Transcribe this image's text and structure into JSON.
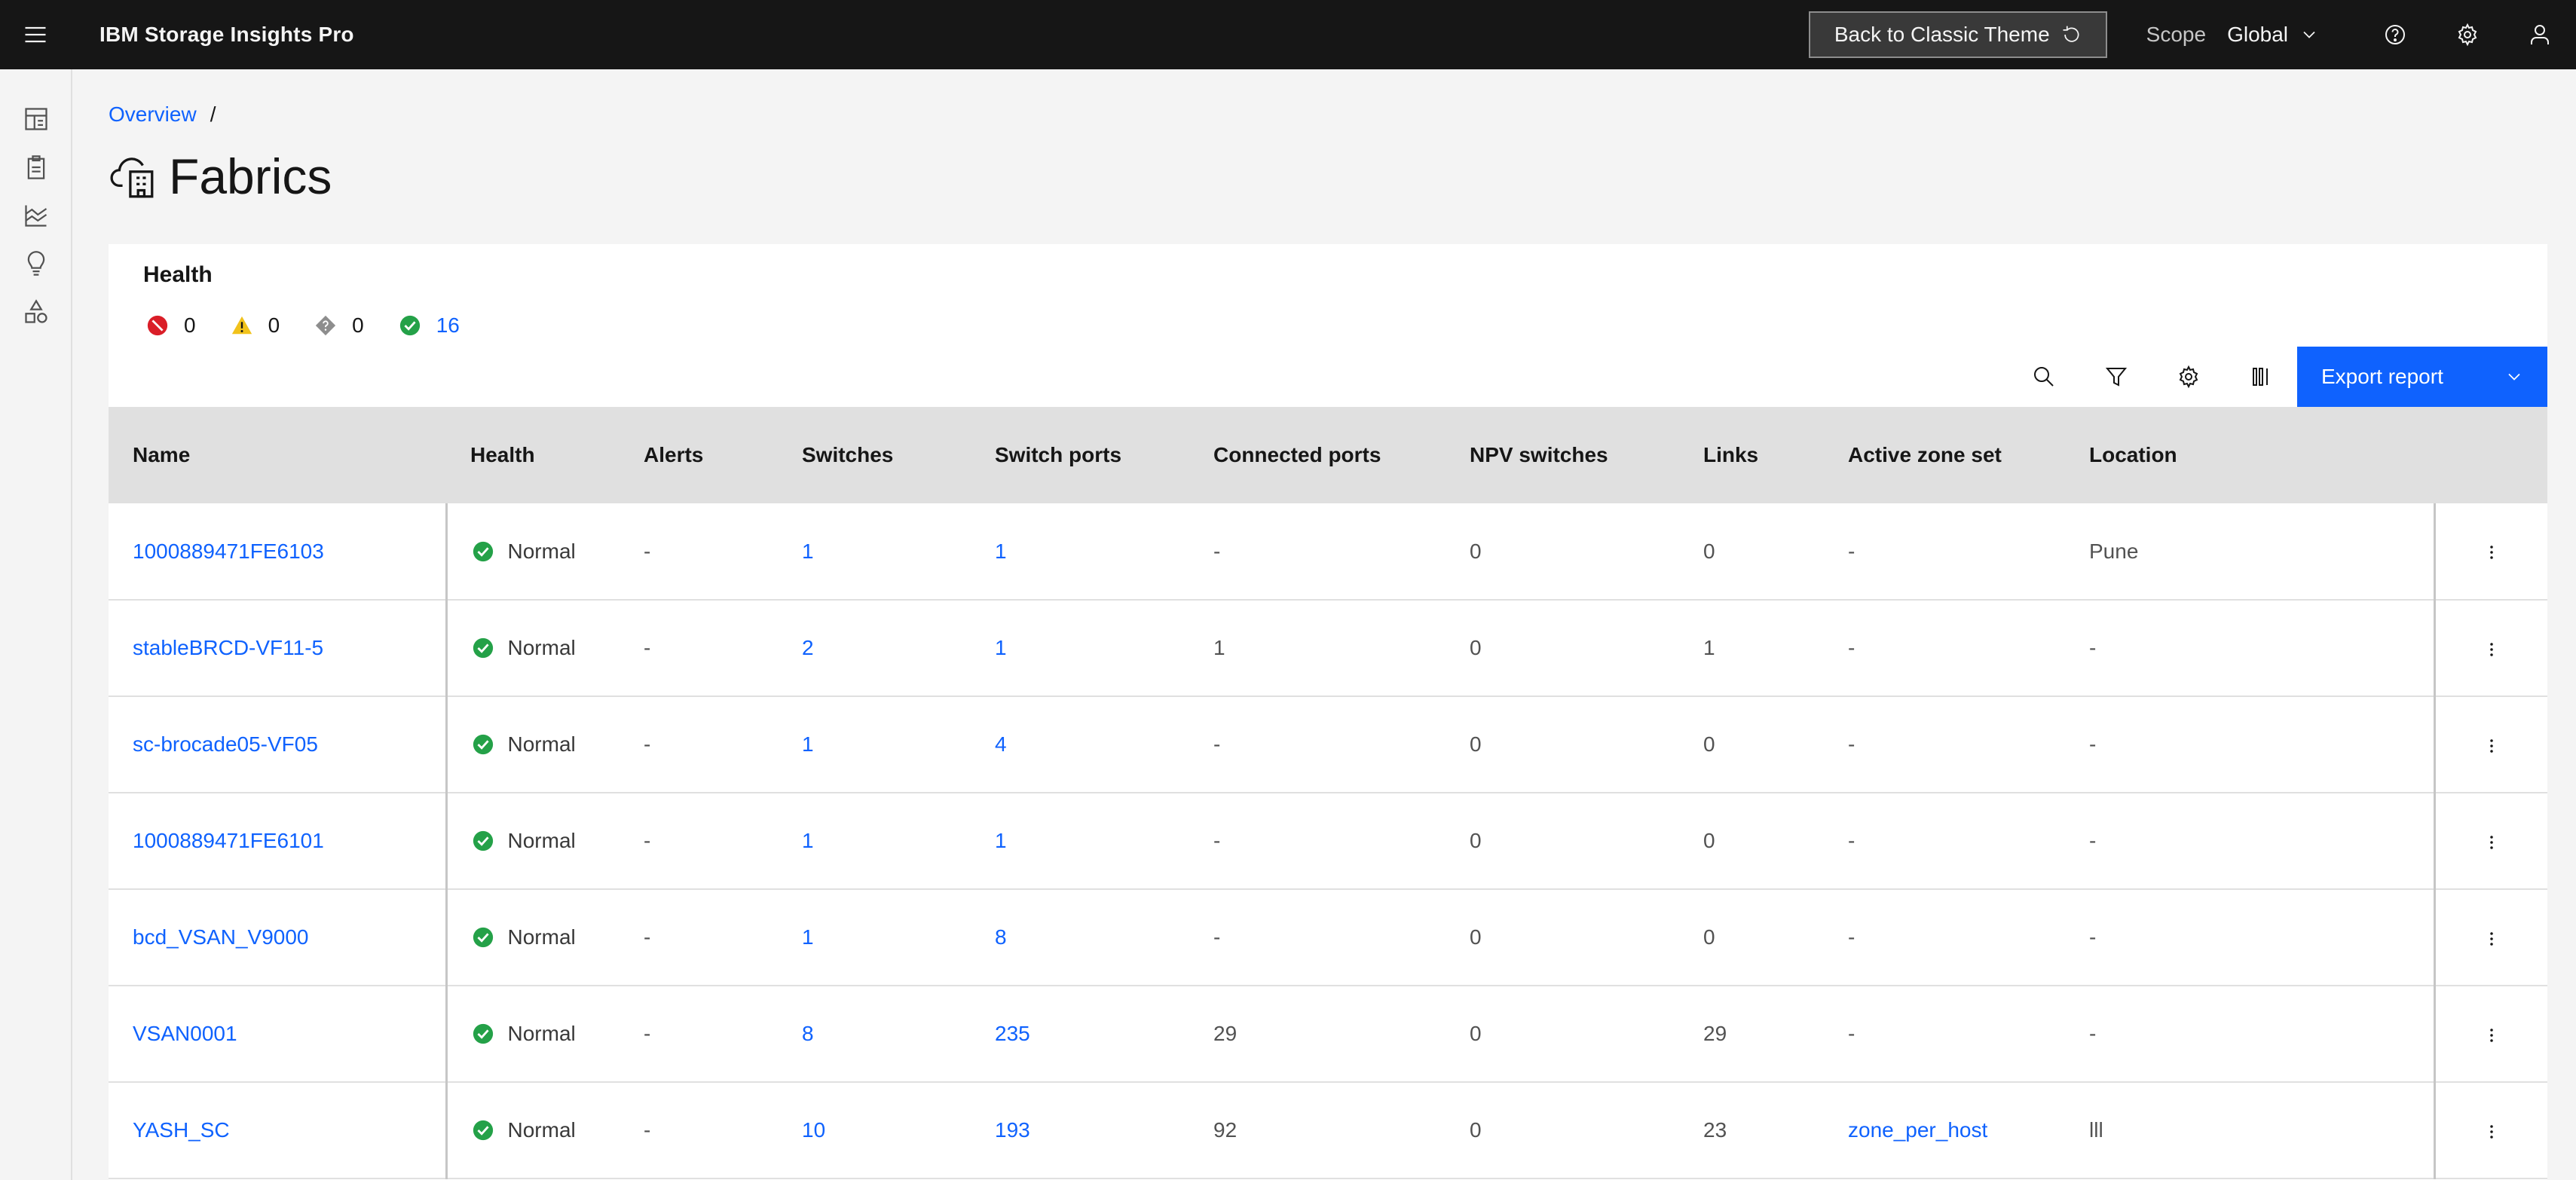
{
  "header": {
    "app_title": "IBM Storage Insights Pro",
    "classic_button": "Back to Classic Theme",
    "scope_label": "Scope",
    "scope_value": "Global"
  },
  "breadcrumb": {
    "overview": "Overview",
    "separator": "/"
  },
  "page": {
    "title": "Fabrics"
  },
  "health": {
    "heading": "Health",
    "error_count": "0",
    "warning_count": "0",
    "unknown_count": "0",
    "normal_count": "16"
  },
  "toolbar": {
    "export_label": "Export report"
  },
  "table": {
    "columns": {
      "name": "Name",
      "health": "Health",
      "alerts": "Alerts",
      "switches": "Switches",
      "switch_ports": "Switch ports",
      "connected_ports": "Connected ports",
      "npv_switches": "NPV switches",
      "links": "Links",
      "active_zone_set": "Active zone set",
      "location": "Location"
    },
    "rows": [
      {
        "name": "1000889471FE6103",
        "health": "Normal",
        "alerts": "-",
        "switches": "1",
        "switch_ports": "1",
        "connected_ports": "-",
        "npv_switches": "0",
        "links": "0",
        "active_zone_set": "-",
        "location": "Pune"
      },
      {
        "name": "stableBRCD-VF11-5",
        "health": "Normal",
        "alerts": "-",
        "switches": "2",
        "switch_ports": "1",
        "connected_ports": "1",
        "npv_switches": "0",
        "links": "1",
        "active_zone_set": "-",
        "location": "-"
      },
      {
        "name": "sc-brocade05-VF05",
        "health": "Normal",
        "alerts": "-",
        "switches": "1",
        "switch_ports": "4",
        "connected_ports": "-",
        "npv_switches": "0",
        "links": "0",
        "active_zone_set": "-",
        "location": "-"
      },
      {
        "name": "1000889471FE6101",
        "health": "Normal",
        "alerts": "-",
        "switches": "1",
        "switch_ports": "1",
        "connected_ports": "-",
        "npv_switches": "0",
        "links": "0",
        "active_zone_set": "-",
        "location": "-"
      },
      {
        "name": "bcd_VSAN_V9000",
        "health": "Normal",
        "alerts": "-",
        "switches": "1",
        "switch_ports": "8",
        "connected_ports": "-",
        "npv_switches": "0",
        "links": "0",
        "active_zone_set": "-",
        "location": "-"
      },
      {
        "name": "VSAN0001",
        "health": "Normal",
        "alerts": "-",
        "switches": "8",
        "switch_ports": "235",
        "connected_ports": "29",
        "npv_switches": "0",
        "links": "29",
        "active_zone_set": "-",
        "location": "-"
      },
      {
        "name": "YASH_SC",
        "health": "Normal",
        "alerts": "-",
        "switches": "10",
        "switch_ports": "193",
        "connected_ports": "92",
        "npv_switches": "0",
        "links": "23",
        "active_zone_set": "zone_per_host",
        "location": "lll"
      }
    ]
  },
  "colors": {
    "accent": "#0f62fe",
    "header_bg": "#161616",
    "error": "#da1e28",
    "warning": "#f1c21b",
    "success": "#24a148",
    "unknown": "#8d8d8d"
  }
}
